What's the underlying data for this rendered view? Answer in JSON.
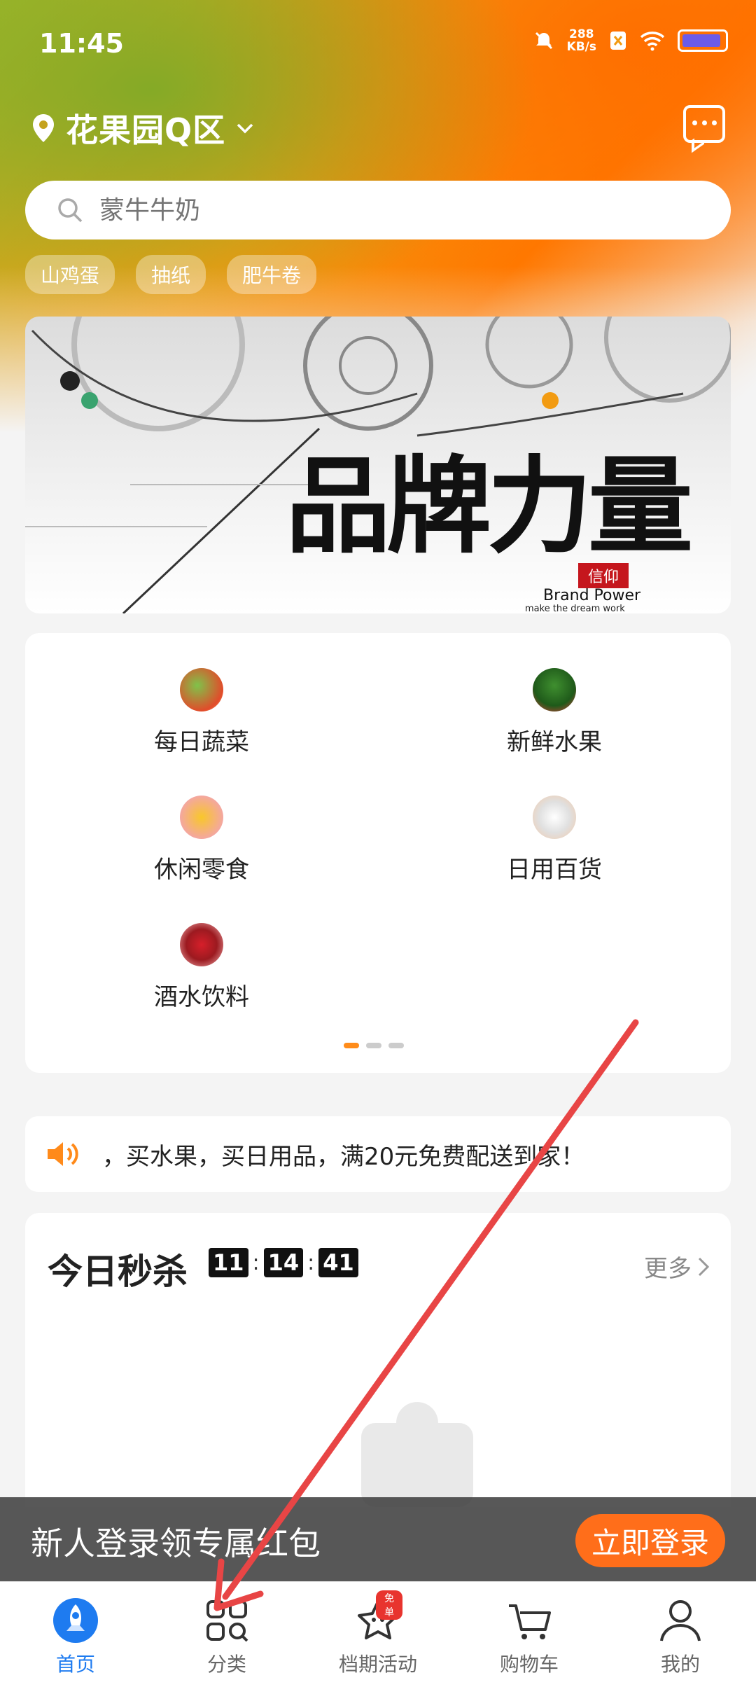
{
  "status_bar": {
    "time": "11:45",
    "speed_value": "288",
    "speed_unit": "KB/s"
  },
  "header": {
    "location": "花果园Q区"
  },
  "search": {
    "placeholder": "蒙牛牛奶",
    "hot_keywords": [
      "山鸡蛋",
      "抽纸",
      "肥牛卷"
    ]
  },
  "banner": {
    "title": "品牌力量",
    "tag": "信仰",
    "sub1": "Brand Power",
    "sub2": "make the dream work"
  },
  "categories": [
    {
      "label": "每日蔬菜",
      "icon": "vegetable-icon"
    },
    {
      "label": "新鲜水果",
      "icon": "watermelon-icon"
    },
    {
      "label": "休闲零食",
      "icon": "snack-icon"
    },
    {
      "label": "日用百货",
      "icon": "kettle-icon"
    },
    {
      "label": "酒水饮料",
      "icon": "drink-icon"
    }
  ],
  "notice": {
    "text": "，买水果，买日用品，满20元免费配送到家！"
  },
  "flash_sale": {
    "title": "今日秒杀",
    "hours": "11",
    "minutes": "14",
    "seconds": "41",
    "more": "更多"
  },
  "login_banner": {
    "text": "新人登录领专属红包",
    "button": "立即登录"
  },
  "tabs": [
    {
      "label": "首页"
    },
    {
      "label": "分类"
    },
    {
      "label": "档期活动",
      "badge": "免单"
    },
    {
      "label": "购物车"
    },
    {
      "label": "我的"
    }
  ],
  "colors": {
    "accent": "#ff6e1a",
    "tab_active": "#1e7bf0",
    "arrow": "#e84545"
  }
}
